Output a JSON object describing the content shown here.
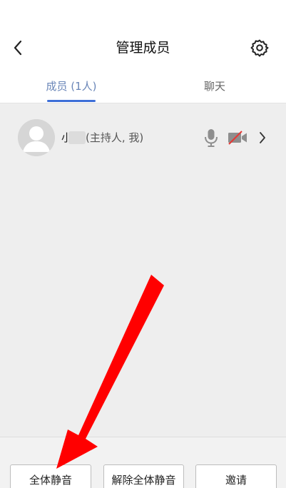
{
  "header": {
    "title": "管理成员",
    "back_icon": "chevron-left-icon",
    "settings_icon": "gear-icon"
  },
  "tabs": [
    {
      "label": "成员 (1人)",
      "active": true
    },
    {
      "label": "聊天",
      "active": false
    }
  ],
  "members": [
    {
      "name": "小",
      "role": "(主持人, 我)",
      "mic_icon": "microphone-icon",
      "camera_icon": "camera-off-icon",
      "more_icon": "chevron-right-icon"
    }
  ],
  "footer": {
    "buttons": [
      {
        "label": "全体静音"
      },
      {
        "label": "解除全体静音"
      },
      {
        "label": "邀请"
      }
    ]
  },
  "colors": {
    "accent": "#3d6fd8",
    "active_tab_text": "#6a86b8",
    "annotation_arrow": "#ff0000",
    "camera_slash": "#e53935"
  }
}
